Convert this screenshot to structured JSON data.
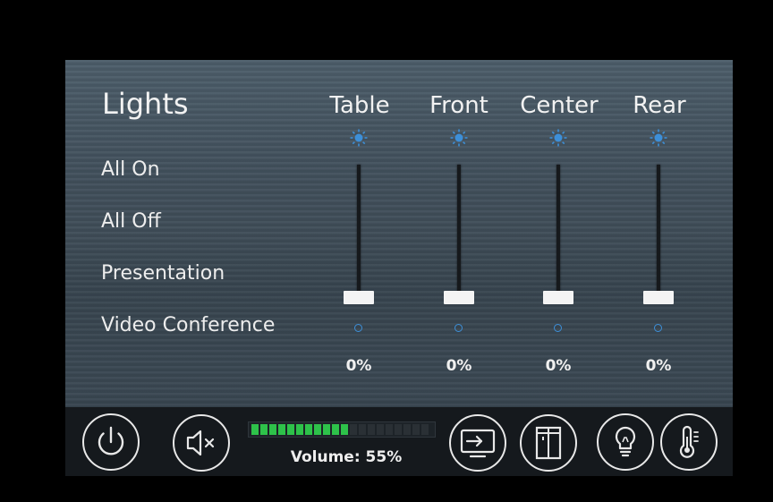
{
  "lights": {
    "title": "Lights",
    "scenes": [
      {
        "label": "All On"
      },
      {
        "label": "All Off"
      },
      {
        "label": "Presentation"
      },
      {
        "label": "Video Conference"
      }
    ],
    "zones": [
      {
        "label": "Table",
        "level": "0%",
        "level_value": 0
      },
      {
        "label": "Front",
        "level": "0%",
        "level_value": 0
      },
      {
        "label": "Center",
        "level": "0%",
        "level_value": 0
      },
      {
        "label": "Rear",
        "level": "0%",
        "level_value": 0
      }
    ]
  },
  "bottom_bar": {
    "volume_label": "Volume: 55%",
    "volume_value": 55,
    "volume_segments_total": 20,
    "volume_segments_lit": 11,
    "buttons": [
      {
        "icon": "power-icon"
      },
      {
        "icon": "mute-icon"
      },
      {
        "icon": "display-icon"
      },
      {
        "icon": "window-icon"
      },
      {
        "icon": "lightbulb-icon"
      },
      {
        "icon": "thermometer-icon"
      }
    ]
  },
  "colors": {
    "accent_blue": "#3d8fd8",
    "volume_green": "#2ec24a",
    "background": "#000000"
  }
}
